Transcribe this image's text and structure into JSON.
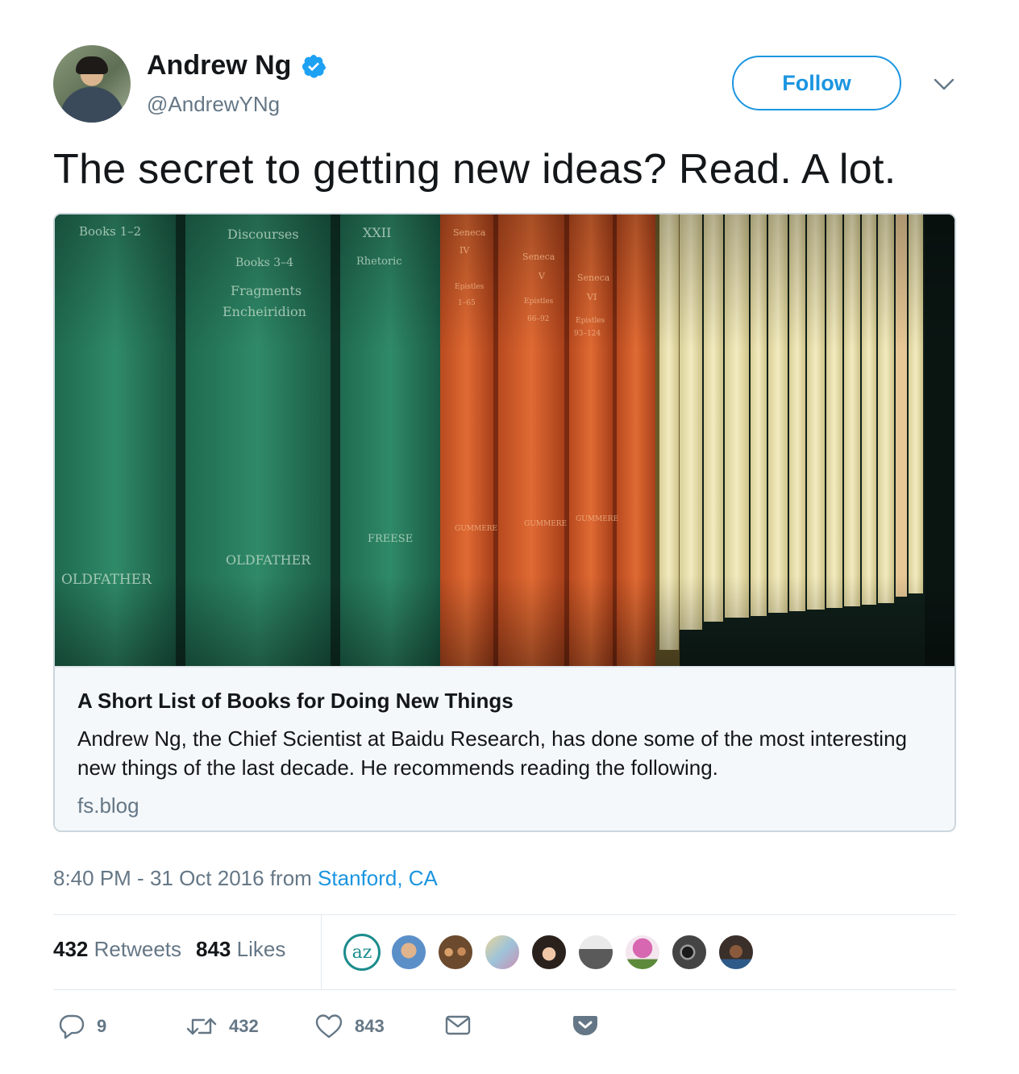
{
  "author": {
    "display_name": "Andrew Ng",
    "handle": "@AndrewYNg",
    "verified": true,
    "avatar_icon": "person-avatar"
  },
  "follow_label": "Follow",
  "tweet_text": "The secret to getting new ideas? Read. A lot.",
  "card": {
    "title": "A Short List of Books for Doing New Things",
    "description": "Andrew Ng, the Chief Scientist at Baidu Research, has done some of the most interesting new things of the last decade. He recommends reading the following.",
    "domain": "fs.blog",
    "image_subject": "bookshelf",
    "spine_texts": {
      "book1": "Books 1–2",
      "book1_author": "OLDFATHER",
      "book2": [
        "Discourses",
        "Books 3–4",
        "Fragments",
        "Encheiridion"
      ],
      "book2_author": "OLDFATHER",
      "book3": [
        "XXII",
        "Rhetoric"
      ],
      "book3_author": "FREESE",
      "book4": [
        "Seneca",
        "IV",
        "Epistles",
        "1–65"
      ],
      "book5": [
        "Seneca",
        "V",
        "Epistles",
        "66–92"
      ],
      "book6": [
        "Seneca",
        "VI",
        "Epistles",
        "93–124"
      ],
      "orange_author": "GUMMERE"
    }
  },
  "meta": {
    "time": "8:40 PM",
    "separator": " - ",
    "date": "31 Oct 2016",
    "from_label": " from ",
    "location": "Stanford, CA"
  },
  "stats": {
    "retweets_count": "432",
    "retweets_label": "Retweets",
    "likes_count": "843",
    "likes_label": "Likes"
  },
  "likers": [
    {
      "icon": "az-logo-avatar",
      "text": "az",
      "color": "#1c8c8c"
    },
    {
      "icon": "smiling-person-avatar",
      "color": "#5b8fc8"
    },
    {
      "icon": "group-photo-avatar",
      "color": "#6b4a2e"
    },
    {
      "icon": "illustration-avatar",
      "color": "#b9c9d4"
    },
    {
      "icon": "woman-avatar",
      "color": "#2a211d"
    },
    {
      "icon": "hands-avatar",
      "color": "#7d7d7d"
    },
    {
      "icon": "pink-tree-avatar",
      "color": "#d667b0"
    },
    {
      "icon": "camera-avatar",
      "color": "#444444"
    },
    {
      "icon": "man-avatar",
      "color": "#3b2f29"
    }
  ],
  "actions": {
    "replies": "9",
    "retweets": "432",
    "likes": "843"
  },
  "colors": {
    "brand_blue": "#1b95e0",
    "text_primary": "#14171a",
    "text_secondary": "#657786",
    "border": "#e1e8ed",
    "card_border": "#ccd6dd",
    "card_bg": "#f5f8fa"
  }
}
